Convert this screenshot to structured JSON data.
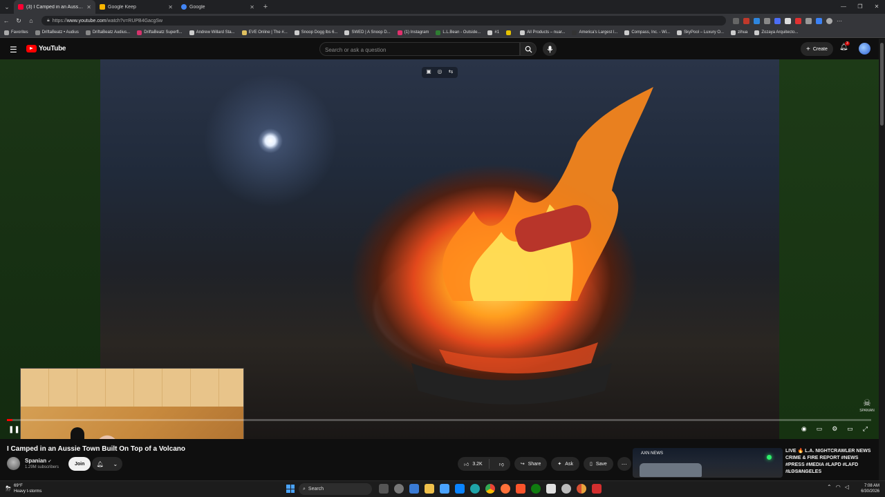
{
  "browser": {
    "tabs": [
      {
        "title": "(3) I Camped in an Aussie Town",
        "active": true,
        "color": "#ff0033"
      },
      {
        "title": "Google Keep",
        "active": false,
        "color": "#f7b500"
      },
      {
        "title": "Google",
        "active": false,
        "color": "#4285f4"
      }
    ],
    "url_prefix": "https://",
    "url_host": "www.youtube.com",
    "url_path": "/watch?v=RUPB4GacgSw",
    "bookmarks": [
      {
        "label": "Favorites",
        "color": "#aaaaaa"
      },
      {
        "label": "DriftaBeatz • Audius",
        "color": "#888888"
      },
      {
        "label": "DriftaBeatz Audius...",
        "color": "#888888"
      },
      {
        "label": "DriftaBeatz Superfl...",
        "color": "#d6336c"
      },
      {
        "label": "Andrew Willard Sta...",
        "color": "#cccccc"
      },
      {
        "label": "EVE Online | The #...",
        "color": "#e0c060"
      },
      {
        "label": "Snoop Dogg lbs 6...",
        "color": "#cccccc"
      },
      {
        "label": "SWED | A Snoop D...",
        "color": "#cccccc"
      },
      {
        "label": "(1) Instagram",
        "color": "#e1306c"
      },
      {
        "label": "L.L.Bean - Outside...",
        "color": "#2e7d32"
      },
      {
        "label": "#1",
        "color": "#cccccc"
      },
      {
        "label": "",
        "color": "#e6c200"
      },
      {
        "label": "All Products – nuar...",
        "color": "#cccccc"
      },
      {
        "label": "America's Largest l...",
        "color": "#333333"
      },
      {
        "label": "Compass, Inc. - Wi...",
        "color": "#cccccc"
      },
      {
        "label": "SkyPool – Luxury O...",
        "color": "#cccccc"
      },
      {
        "label": "zihua",
        "color": "#cccccc"
      },
      {
        "label": "Zozaya Arquitecto...",
        "color": "#cccccc"
      }
    ]
  },
  "youtube": {
    "logo_text": "YouTube",
    "search_placeholder": "Search or ask a question",
    "create_label": "Create",
    "notifications_count": "3"
  },
  "video": {
    "title": "I Camped in an Aussie Town Built On Top of a Volcano",
    "progress": 0.006,
    "watermark": "SPANIAN"
  },
  "channel": {
    "name": "Spanian",
    "subscribers": "1.29M subscribers",
    "join_label": "Join"
  },
  "actions": {
    "likes": "3.2K",
    "share": "Share",
    "ask": "Ask",
    "save": "Save"
  },
  "related": {
    "title": "LIVE 🔥 L.A. NIGHTCRAWLER NEWS CRIME & FIRE REPORT #NEWS #PRESS #MEDIA #LAPD #LAFD #LOSANGELES",
    "channel": "AXN NEWS",
    "thumb_tag": "AXN NEWS"
  },
  "taskbar": {
    "temp": "69°F",
    "weather": "Heavy t-storms",
    "search_label": "Search",
    "time": "7:08 AM",
    "date": "6/30/2026"
  }
}
